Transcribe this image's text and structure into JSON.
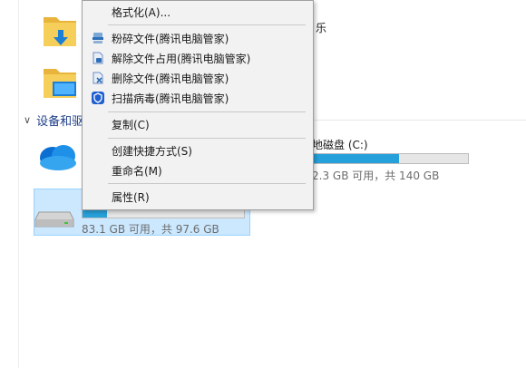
{
  "section": {
    "title": "设备和驱"
  },
  "partial_label": "乐",
  "menu": {
    "items": [
      {
        "label": "格式化(A)...",
        "icon": ""
      },
      {
        "label": "粉碎文件(腾讯电脑管家)",
        "icon": "shred-icon"
      },
      {
        "label": "解除文件占用(腾讯电脑管家)",
        "icon": "unlock-file-icon"
      },
      {
        "label": "删除文件(腾讯电脑管家)",
        "icon": "delete-file-icon"
      },
      {
        "label": "扫描病毒(腾讯电脑管家)",
        "icon": "shield-scan-icon"
      },
      {
        "label": "复制(C)",
        "icon": ""
      },
      {
        "label": "创建快捷方式(S)",
        "icon": ""
      },
      {
        "label": "重命名(M)",
        "icon": ""
      },
      {
        "label": "属性(R)",
        "icon": ""
      }
    ]
  },
  "drives": [
    {
      "name": "地磁盘 (C:)",
      "sizes": "2.3 GB 可用，共 140 GB",
      "used_fraction": 0.56
    },
    {
      "name": "",
      "sizes": "83.1 GB 可用，共 97.6 GB",
      "used_fraction": 0.15
    }
  ],
  "colors": {
    "accent": "#26a0da",
    "selection": "#cce8ff",
    "header": "#1f3f8a"
  }
}
